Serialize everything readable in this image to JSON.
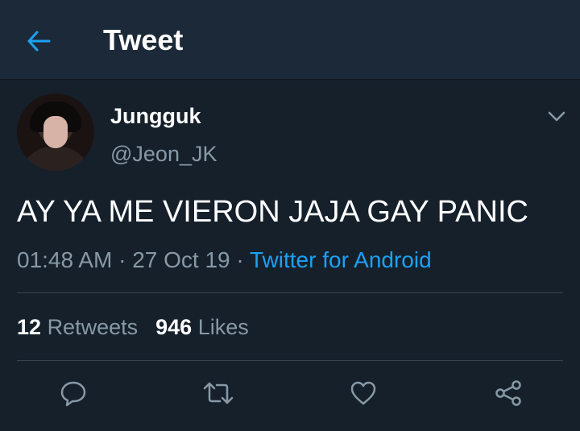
{
  "header": {
    "title": "Tweet",
    "back_icon": "arrow-left-icon"
  },
  "colors": {
    "background": "#15202b",
    "header": "#1c2938",
    "accent": "#1da1f2",
    "muted": "#8899a6",
    "divider": "#38444d"
  },
  "tweet": {
    "author_name": "Jungguk",
    "author_handle": "@Jeon_JK",
    "text": "AY YA ME VIERON JAJA GAY PANIC",
    "time": "01:48 AM",
    "date": "27 Oct 19",
    "separator": " · ",
    "source": "Twitter for Android"
  },
  "stats": {
    "retweets_count": "12",
    "retweets_label": "Retweets",
    "likes_count": "946",
    "likes_label": "Likes"
  },
  "actions": [
    "reply-icon",
    "retweet-icon",
    "like-icon",
    "share-icon"
  ]
}
